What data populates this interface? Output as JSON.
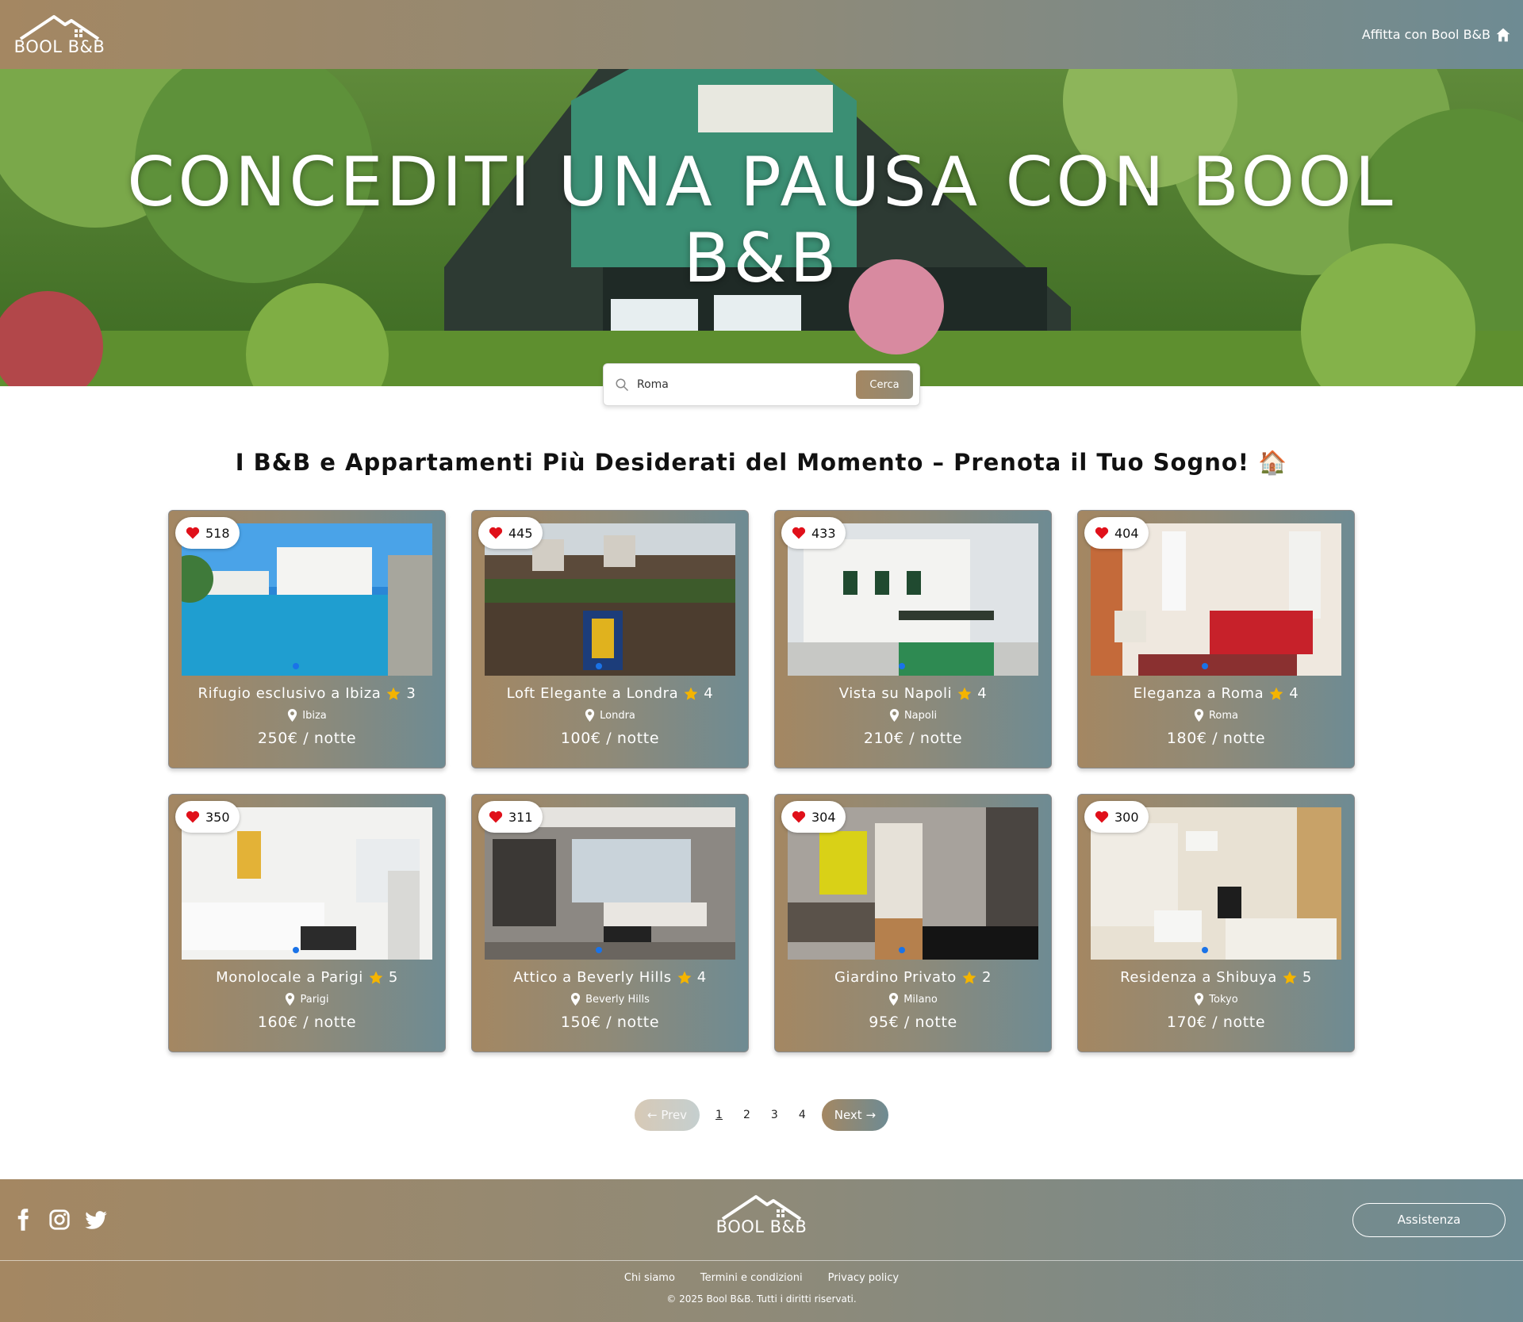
{
  "header": {
    "logo_text": "BOOL B&B",
    "host_link": "Affitta con Bool B&B"
  },
  "hero": {
    "title": "CONCEDITI UNA PAUSA CON BOOL B&B"
  },
  "search": {
    "value": "Roma",
    "button": "Cerca"
  },
  "section_title": "I B&B e Appartamenti Più Desiderati del Momento – Prenota il Tuo Sogno! 🏠",
  "listings": [
    {
      "likes": "518",
      "title": "Rifugio esclusivo a Ibiza",
      "rating": "3",
      "city": "Ibiza",
      "price": "250€ / notte"
    },
    {
      "likes": "445",
      "title": "Loft Elegante a Londra",
      "rating": "4",
      "city": "Londra",
      "price": "100€ / notte"
    },
    {
      "likes": "433",
      "title": "Vista su Napoli",
      "rating": "4",
      "city": "Napoli",
      "price": "210€ / notte"
    },
    {
      "likes": "404",
      "title": "Eleganza a Roma",
      "rating": "4",
      "city": "Roma",
      "price": "180€ / notte"
    },
    {
      "likes": "350",
      "title": "Monolocale a Parigi",
      "rating": "5",
      "city": "Parigi",
      "price": "160€ / notte"
    },
    {
      "likes": "311",
      "title": "Attico a Beverly Hills",
      "rating": "4",
      "city": "Beverly Hills",
      "price": "150€ / notte"
    },
    {
      "likes": "304",
      "title": "Giardino Privato",
      "rating": "2",
      "city": "Milano",
      "price": "95€ / notte"
    },
    {
      "likes": "300",
      "title": "Residenza a Shibuya",
      "rating": "5",
      "city": "Tokyo",
      "price": "170€ / notte"
    }
  ],
  "pagination": {
    "prev": "← Prev",
    "pages": [
      "1",
      "2",
      "3",
      "4"
    ],
    "next": "Next →"
  },
  "footer": {
    "logo_text": "BOOL B&B",
    "assist_button": "Assistenza",
    "links": [
      "Chi siamo",
      "Termini e condizioni",
      "Privacy policy"
    ],
    "copyright": "© 2025 Bool B&B. Tutti i diritti riservati."
  },
  "colors": {
    "gradient_start": "#a48762",
    "gradient_end": "#6e8b93",
    "heart": "#e0101a",
    "star": "#f4b400",
    "carousel_dot": "#1a73e8"
  }
}
